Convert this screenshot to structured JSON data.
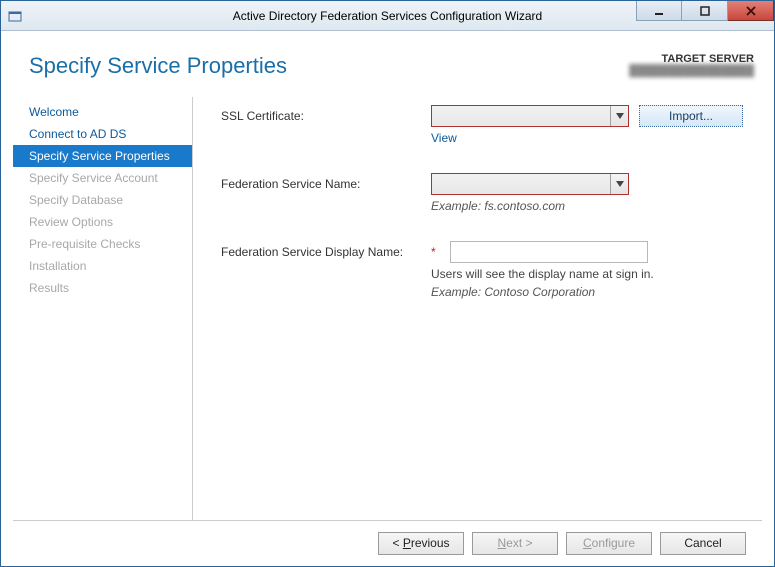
{
  "window": {
    "title": "Active Directory Federation Services Configuration Wizard"
  },
  "header": {
    "page_title": "Specify Service Properties",
    "target_label": "TARGET SERVER",
    "target_server": "████████████████"
  },
  "sidebar": {
    "items": [
      {
        "label": "Welcome",
        "state": "link"
      },
      {
        "label": "Connect to AD DS",
        "state": "link"
      },
      {
        "label": "Specify Service Properties",
        "state": "active"
      },
      {
        "label": "Specify Service Account",
        "state": "disabled"
      },
      {
        "label": "Specify Database",
        "state": "disabled"
      },
      {
        "label": "Review Options",
        "state": "disabled"
      },
      {
        "label": "Pre-requisite Checks",
        "state": "disabled"
      },
      {
        "label": "Installation",
        "state": "disabled"
      },
      {
        "label": "Results",
        "state": "disabled"
      }
    ]
  },
  "form": {
    "ssl_cert": {
      "label": "SSL Certificate:",
      "value": "",
      "import_button": "Import...",
      "view_link": "View"
    },
    "fed_service_name": {
      "label": "Federation Service Name:",
      "value": "",
      "example": "Example: fs.contoso.com"
    },
    "fed_display_name": {
      "label": "Federation Service Display Name:",
      "value": "",
      "required_marker": "*",
      "info": "Users will see the display name at sign in.",
      "example": "Example: Contoso Corporation"
    }
  },
  "footer": {
    "previous_full": "< Previous",
    "next": "Next >",
    "configure": "Configure",
    "cancel": "Cancel",
    "prev_prefix": "< ",
    "prev_letter": "P",
    "prev_rest": "revious",
    "next_letter": "N",
    "next_rest": "ext >",
    "cfg_letter": "C",
    "cfg_rest": "onfigure"
  }
}
